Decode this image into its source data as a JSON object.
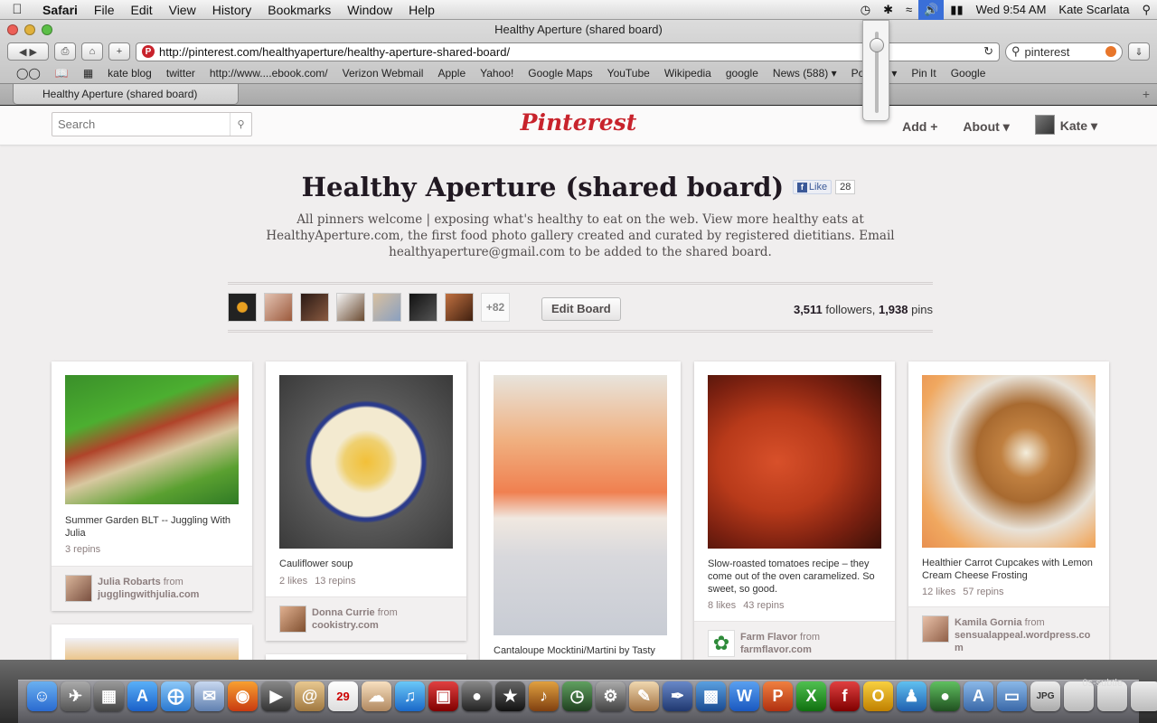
{
  "menubar": {
    "app": "Safari",
    "menus": [
      "File",
      "Edit",
      "View",
      "History",
      "Bookmarks",
      "Window",
      "Help"
    ],
    "clock": "Wed 9:54 AM",
    "user": "Kate Scarlata"
  },
  "browser": {
    "window_title": "Healthy Aperture (shared board)",
    "url": "http://pinterest.com/healthyaperture/healthy-aperture-shared-board/",
    "search_value": "pinterest",
    "bookmarks": [
      "kate blog",
      "twitter",
      "http://www....ebook.com/",
      "Verizon Webmail",
      "Apple",
      "Yahoo!",
      "Google Maps",
      "YouTube",
      "Wikipedia",
      "google",
      "News (588) ▾",
      "Popular ▾",
      "Pin It",
      "Google"
    ],
    "tab_title": "Healthy Aperture (shared board)",
    "volume_percent": 90
  },
  "site": {
    "search_placeholder": "Search",
    "logo": "Pinterest",
    "nav_add": "Add +",
    "nav_about": "About ▾",
    "nav_user": "Kate ▾"
  },
  "board": {
    "title": "Healthy Aperture (shared board)",
    "like_label": "Like",
    "like_count": "28",
    "description": "All pinners welcome | exposing what's healthy to eat on the web. View more healthy eats at HealthyAperture.com, the first food photo gallery created and curated by registered dietitians. Email healthyaperture@gmail.com to be added to the shared board.",
    "more_pinners": "+82",
    "edit_button": "Edit Board",
    "followers": "3,511",
    "followers_label": "followers,",
    "pins": "1,938",
    "pins_label": "pins"
  },
  "pins": [
    {
      "desc": "Summer Garden BLT -- Juggling With Julia",
      "likes": "",
      "repins": "3 repins",
      "user": "Julia Robarts",
      "from": "from",
      "source": "jugglingwithjulia.com"
    },
    {
      "desc": "Cauliflower soup",
      "likes": "2 likes",
      "repins": "13 repins",
      "user": "Donna Currie",
      "from": "from",
      "source": "cookistry.com"
    },
    {
      "desc": "Cantaloupe Mocktini/Martini by Tasty",
      "likes": "",
      "repins": "",
      "user": "",
      "from": "",
      "source": ""
    },
    {
      "desc": "Slow-roasted tomatoes recipe – they come out of the oven caramelized. So sweet, so good.",
      "likes": "8 likes",
      "repins": "43 repins",
      "user": "Farm Flavor",
      "from": "from",
      "source": "farmflavor.com"
    },
    {
      "desc": "Healthier Carrot Cupcakes with Lemon Cream Cheese Frosting",
      "likes": "12 likes",
      "repins": "57 repins",
      "user": "Kamila Gornia",
      "from": "from",
      "source": "sensualappeal.wordpress.com"
    }
  ],
  "dock": {
    "label": "0s-subtle"
  },
  "colors": {
    "brand": "#c8232c",
    "page_bg": "#f0eeee"
  }
}
